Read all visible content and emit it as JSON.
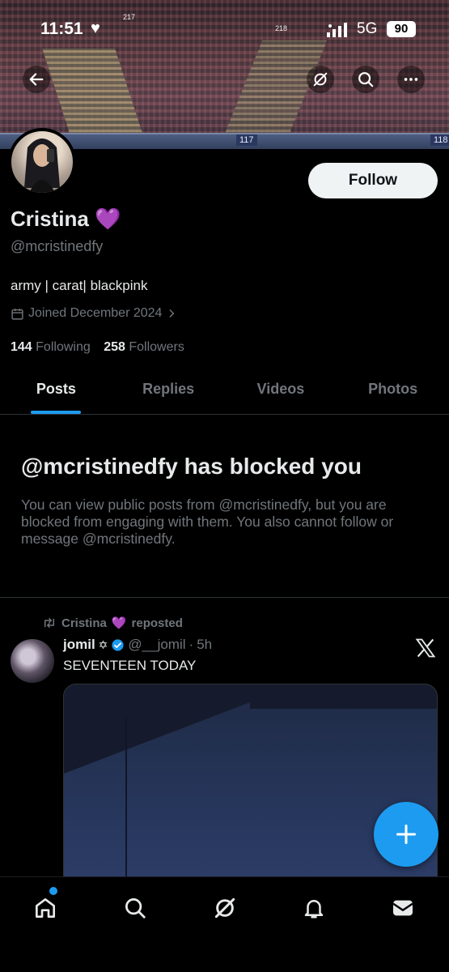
{
  "status": {
    "time": "11:51",
    "network": "5G",
    "battery": "90"
  },
  "banner": {
    "sections": [
      "117",
      "118"
    ],
    "upper_sections": [
      "217",
      "218"
    ]
  },
  "profile": {
    "name": "Cristina",
    "name_emoji": "💜",
    "handle": "@mcristinedfy",
    "bio": "army | carat| blackpink",
    "joined": "Joined December 2024",
    "following_count": "144",
    "following_label": "Following",
    "followers_count": "258",
    "followers_label": "Followers",
    "follow_button": "Follow"
  },
  "tabs": [
    {
      "label": "Posts",
      "active": true
    },
    {
      "label": "Replies",
      "active": false
    },
    {
      "label": "Videos",
      "active": false
    },
    {
      "label": "Photos",
      "active": false
    }
  ],
  "blocked": {
    "title": "@mcristinedfy has blocked you",
    "message": "You can view public posts from @mcristinedfy, but you are blocked from engaging with them. You also cannot follow or message @mcristinedfy."
  },
  "post": {
    "repost_name": "Cristina",
    "repost_emoji": "💜",
    "repost_label": "reposted",
    "author_name": "jomil",
    "author_symbol": "✡",
    "author_handle": "@__jomil",
    "separator": "·",
    "time": "5h",
    "text": "SEVENTEEN TODAY"
  },
  "colors": {
    "accent": "#1d9bf0",
    "background": "#000000",
    "text_primary": "#e7e9ea",
    "text_secondary": "#71767b"
  }
}
